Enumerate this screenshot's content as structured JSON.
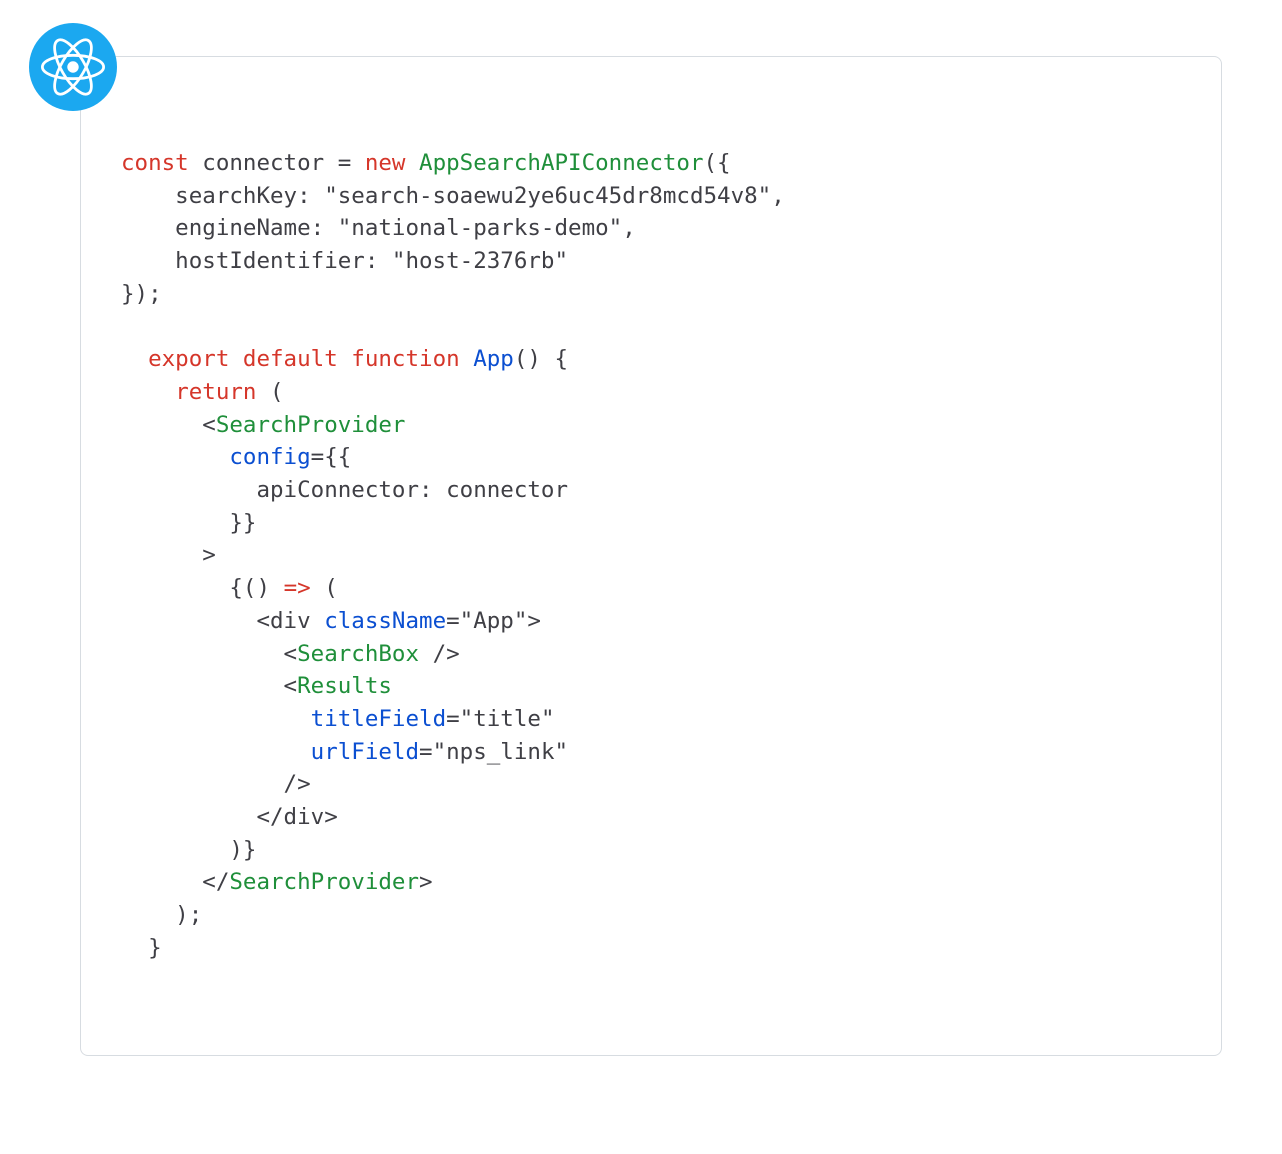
{
  "code": {
    "l1_kw1": "const",
    "l1_id": " connector ",
    "l1_eq": "= ",
    "l1_kw2": "new",
    "l1_sp": " ",
    "l1_fn": "AppSearchAPIConnector",
    "l1_tail": "({",
    "l2": "    searchKey: \"search-soaewu2ye6uc45dr8mcd54v8\",",
    "l3": "    engineName: \"national-parks-demo\",",
    "l4": "    hostIdentifier: \"host-2376rb\"",
    "l5": "});",
    "l7_kw1": "  export",
    "l7_kw2": " default",
    "l7_kw3": " function",
    "l7_sp": " ",
    "l7_fn": "App",
    "l7_tail": "() {",
    "l8_pre": "    ",
    "l8_kw": "return",
    "l8_tail": " (",
    "l9_pre": "      <",
    "l9_tag": "SearchProvider",
    "l10_pre": "        ",
    "l10_attr": "config",
    "l10_tail": "={{",
    "l11": "          apiConnector: connector",
    "l12": "        }}",
    "l13": "      >",
    "l14_pre": "        {() ",
    "l14_arrow": "=>",
    "l14_tail": " (",
    "l15_pre": "          <div ",
    "l15_attr": "className",
    "l15_tail": "=\"App\">",
    "l16_pre": "            <",
    "l16_tag": "SearchBox",
    "l16_tail": " />",
    "l17_pre": "            <",
    "l17_tag": "Results",
    "l18_pre": "              ",
    "l18_attr": "titleField",
    "l18_tail": "=\"title\"",
    "l19_pre": "              ",
    "l19_attr": "urlField",
    "l19_tail": "=\"nps_link\"",
    "l20": "            />",
    "l21": "          </div>",
    "l22": "        )}",
    "l23_pre": "      </",
    "l23_tag": "SearchProvider",
    "l23_tail": ">",
    "l24": "    );",
    "l25": "  }"
  }
}
